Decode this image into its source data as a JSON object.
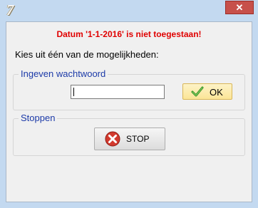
{
  "window": {
    "icon": "app-seven-icon",
    "close_glyph": "✕"
  },
  "error": {
    "text": "Datum '1-1-2016' is niet toegestaan!",
    "color": "#e00000"
  },
  "prompt": {
    "text": "Kies uit één van de mogelijkheden:"
  },
  "password_group": {
    "legend": "Ingeven wachtwoord",
    "input_value": "",
    "ok_label": "OK",
    "ok_icon": "checkmark-icon"
  },
  "stop_group": {
    "legend": "Stoppen",
    "stop_label": "STOP",
    "stop_icon": "red-x-icon"
  }
}
